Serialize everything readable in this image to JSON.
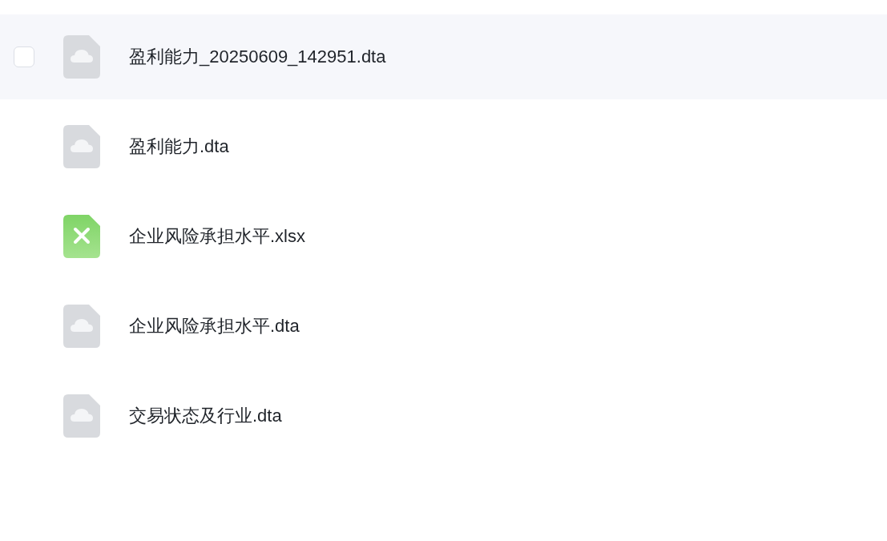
{
  "files": [
    {
      "name": "盈利能力_20250609_142951.dta",
      "kind": "dta",
      "highlighted": true,
      "checkbox": {
        "checked": false
      }
    },
    {
      "name": "盈利能力.dta",
      "kind": "dta",
      "highlighted": false
    },
    {
      "name": "企业风险承担水平.xlsx",
      "kind": "xlsx",
      "highlighted": false
    },
    {
      "name": "企业风险承担水平.dta",
      "kind": "dta",
      "highlighted": false
    },
    {
      "name": "交易状态及行业.dta",
      "kind": "dta",
      "highlighted": false
    }
  ]
}
